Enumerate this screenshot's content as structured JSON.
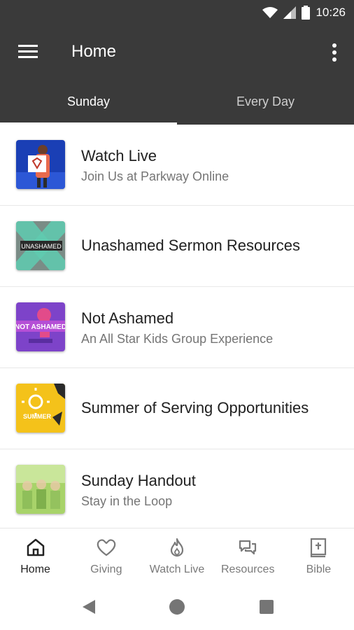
{
  "status": {
    "time": "10:26"
  },
  "appbar": {
    "title": "Home"
  },
  "tabs": [
    {
      "label": "Sunday",
      "active": true
    },
    {
      "label": "Every Day",
      "active": false
    }
  ],
  "items": [
    {
      "title": "Watch Live",
      "subtitle": "Join Us at Parkway Online"
    },
    {
      "title": "Unashamed Sermon Resources",
      "subtitle": "",
      "thumb_text": "UNASHAMED"
    },
    {
      "title": "Not Ashamed",
      "subtitle": "An All Star Kids Group Experience",
      "thumb_text": "NOT ASHAMED"
    },
    {
      "title": "Summer of Serving Opportunities",
      "subtitle": "",
      "thumb_text": "SUMMER"
    },
    {
      "title": "Sunday Handout",
      "subtitle": "Stay in the Loop"
    }
  ],
  "bottom_nav": [
    {
      "label": "Home",
      "icon": "home-icon",
      "active": true
    },
    {
      "label": "Giving",
      "icon": "heart-icon",
      "active": false
    },
    {
      "label": "Watch Live",
      "icon": "flame-icon",
      "active": false
    },
    {
      "label": "Resources",
      "icon": "chat-bubbles-icon",
      "active": false
    },
    {
      "label": "Bible",
      "icon": "bible-icon",
      "active": false
    }
  ],
  "colors": {
    "bar": "#3a3a3a",
    "text": "#212121",
    "subtext": "#757575"
  }
}
